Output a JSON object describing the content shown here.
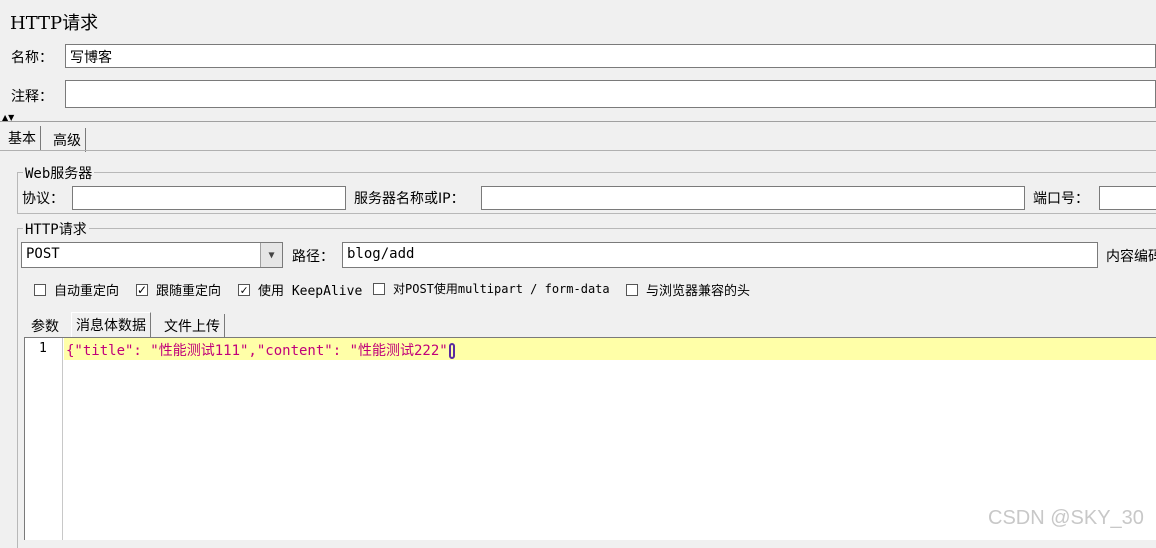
{
  "window": {
    "title": "HTTP请求"
  },
  "name_row": {
    "label": "名称：",
    "value": "写博客"
  },
  "comment_row": {
    "label": "注释：",
    "value": ""
  },
  "main_tabs": [
    {
      "label": "基本"
    },
    {
      "label": "高级"
    }
  ],
  "web_server": {
    "legend": "Web服务器",
    "protocol_label": "协议：",
    "protocol_value": "",
    "server_label": "服务器名称或IP：",
    "server_value": "",
    "port_label": "端口号：",
    "port_value": ""
  },
  "http_request": {
    "legend": "HTTP请求",
    "method": "POST",
    "path_label": "路径：",
    "path_value": "blog/add",
    "encoding_label": "内容编码"
  },
  "options": [
    {
      "label": "自动重定向",
      "checked": false
    },
    {
      "label": "跟随重定向",
      "checked": true
    },
    {
      "label": "使用 KeepAlive",
      "checked": true
    },
    {
      "label": "对POST使用multipart / form-data",
      "checked": false
    },
    {
      "label": "与浏览器兼容的头",
      "checked": false
    }
  ],
  "body_tabs": [
    {
      "label": "参数"
    },
    {
      "label": "消息体数据"
    },
    {
      "label": "文件上传"
    }
  ],
  "editor": {
    "line_number": "1",
    "code": "{\"title\": \"性能测试111\",\"content\": \"性能测试222\"",
    "code_end": "}"
  },
  "watermark": "CSDN @SKY_30",
  "colors": {
    "highlight": "#ffffa8",
    "code_text": "#c0007a"
  }
}
